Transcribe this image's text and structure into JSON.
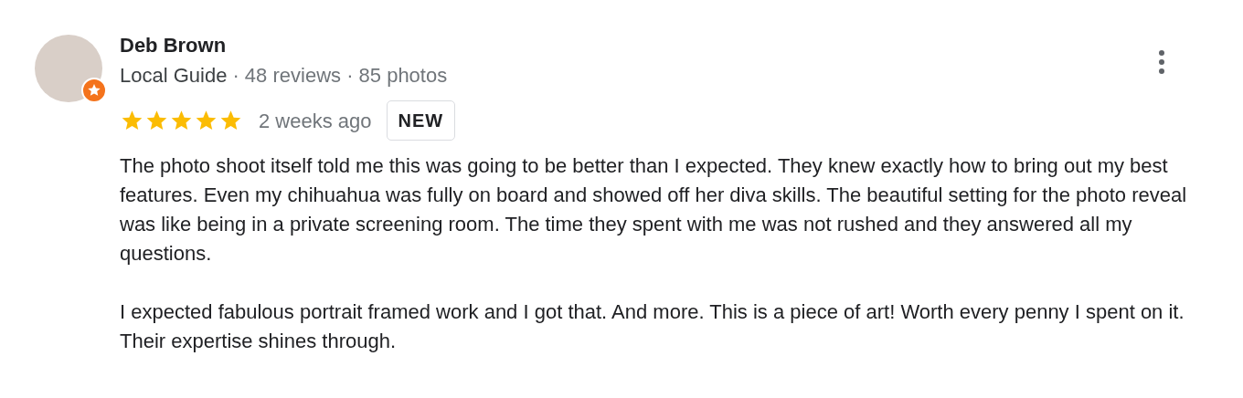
{
  "review": {
    "author": "Deb Brown",
    "author_level": "Local Guide",
    "author_stats": "· 48 reviews · 85 photos",
    "stars": 5,
    "time": "2 weeks ago",
    "tag": "NEW",
    "paragraphs": [
      "The photo shoot itself told me this was going to be better than I expected. They knew exactly how to bring out my best features. Even my chihuahua was fully on board and showed off her diva skills. The beautiful setting for the photo reveal was like being in a private screening room. The time they spent with me was not rushed and they answered all my questions.",
      "I expected fabulous portrait framed work and I got that. And more. This is a piece of art! Worth every penny I spent on it. Their expertise shines through."
    ]
  }
}
